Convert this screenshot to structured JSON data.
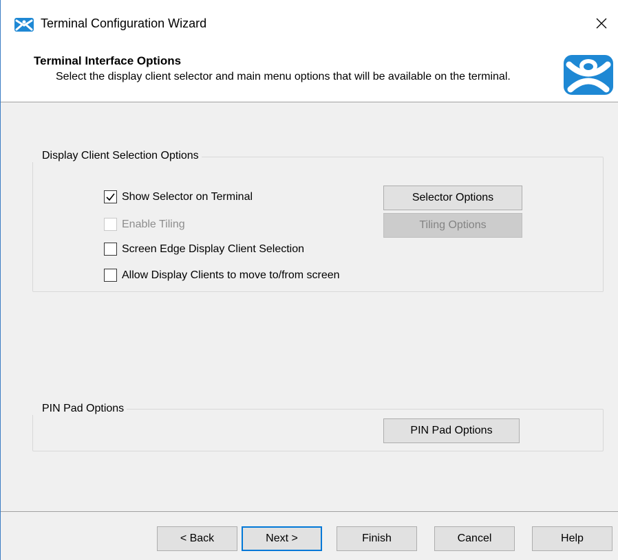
{
  "window": {
    "title": "Terminal Configuration Wizard",
    "close_glyph": "✕"
  },
  "header": {
    "title": "Terminal Interface Options",
    "subtitle": "Select the display client selector and main menu options that will be available on the terminal.",
    "logo_icon": "thinmanager-logo-icon"
  },
  "display_client_group": {
    "legend": "Display Client Selection Options",
    "show_selector": {
      "label": "Show Selector on Terminal",
      "checked": true,
      "enabled": true
    },
    "enable_tiling": {
      "label": "Enable Tiling",
      "checked": false,
      "enabled": false
    },
    "screen_edge": {
      "label": "Screen Edge Display Client Selection",
      "checked": false,
      "enabled": true
    },
    "allow_move": {
      "label": "Allow Display Clients to move to/from screen",
      "checked": false,
      "enabled": true
    },
    "selector_options_label": "Selector Options",
    "tiling_options_label": "Tiling Options"
  },
  "pin_pad_group": {
    "legend": "PIN Pad Options",
    "button_label": "PIN Pad Options"
  },
  "footer": {
    "back_label": "< Back",
    "next_label": "Next >",
    "finish_label": "Finish",
    "cancel_label": "Cancel",
    "help_label": "Help"
  },
  "colors": {
    "accent": "#0078d7",
    "logo_blue": "#1e88d4"
  }
}
